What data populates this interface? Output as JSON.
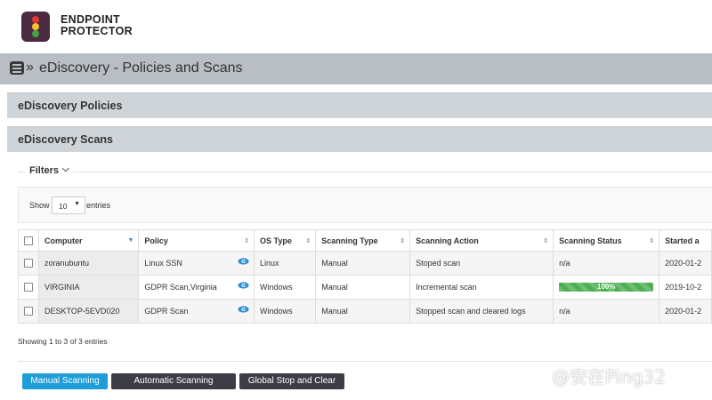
{
  "brand": {
    "line1": "ENDPOINT",
    "line2": "PROTECTOR"
  },
  "titlebar": {
    "separator": "»",
    "title": "eDiscovery - Policies and Scans"
  },
  "sections": {
    "policies": "eDiscovery Policies",
    "scans": "eDiscovery Scans"
  },
  "filters": {
    "label": "Filters"
  },
  "entries": {
    "show_label": "Show",
    "value": "10",
    "suffix": "entries"
  },
  "table": {
    "columns": [
      "Computer",
      "Policy",
      "OS Type",
      "Scanning Type",
      "Scanning Action",
      "Scanning Status",
      "Started a"
    ],
    "rows": [
      {
        "computer": "zoranubuntu",
        "policy": "Linux SSN",
        "os": "Linux",
        "type": "Manual",
        "action": "Stoped scan",
        "status": "n/a",
        "started": "2020-01-2"
      },
      {
        "computer": "VIRGINIA",
        "policy": "GDPR Scan,Virginia",
        "os": "Windows",
        "type": "Manual",
        "action": "Incremental scan",
        "status_progress": "100%",
        "status_fraction": 1.0,
        "started": "2019-10-2"
      },
      {
        "computer": "DESKTOP-5EVD020",
        "policy": "GDPR Scan",
        "os": "Windows",
        "type": "Manual",
        "action": "Stopped scan and cleared logs",
        "status": "n/a",
        "started": "2020-01-2"
      }
    ]
  },
  "info": {
    "showing": "Showing 1 to 3 of 3 entries"
  },
  "buttons": {
    "manual": "Manual Scanning",
    "automatic": "Automatic Scanning",
    "stop": "Global Stop and Clear"
  },
  "watermark": "​@安在Ping32",
  "colors": {
    "accent": "#1f9dd9",
    "progress": "#4caf50",
    "dark_button": "#3d3d46",
    "titlebar": "#b9bec4"
  }
}
